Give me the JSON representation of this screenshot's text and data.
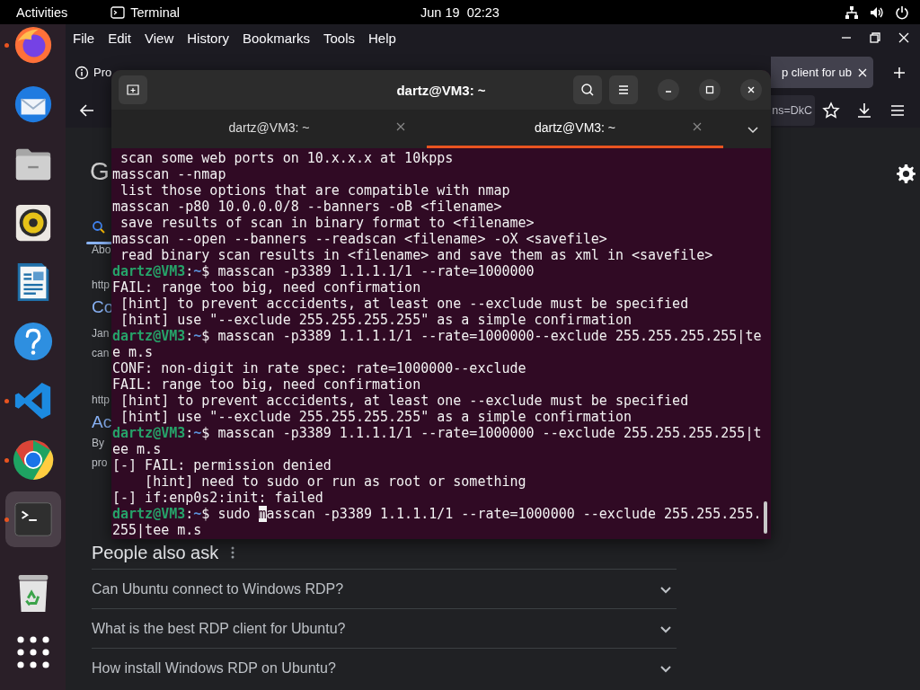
{
  "top_bar": {
    "activities": "Activities",
    "app": "Terminal",
    "clock": "Jun 19  02:23"
  },
  "dock": {
    "items": [
      {
        "kind": "firefox",
        "running": true,
        "selected": false
      },
      {
        "kind": "thunderbird",
        "running": false,
        "selected": false
      },
      {
        "kind": "files",
        "running": false,
        "selected": false
      },
      {
        "kind": "rhythmbox",
        "running": false,
        "selected": false
      },
      {
        "kind": "writer",
        "running": false,
        "selected": false
      },
      {
        "kind": "help",
        "running": false,
        "selected": false
      },
      {
        "kind": "vscode",
        "running": true,
        "selected": false
      },
      {
        "kind": "chrome",
        "running": true,
        "selected": false
      },
      {
        "kind": "terminal",
        "running": true,
        "selected": true
      },
      {
        "kind": "trash",
        "running": false,
        "selected": false
      }
    ]
  },
  "browser": {
    "menu": [
      "File",
      "Edit",
      "View",
      "History",
      "Bookmarks",
      "Tools",
      "Help"
    ],
    "tabs": [
      {
        "label": "Pro",
        "selected": false
      },
      {
        "label": "p client for ub",
        "selected": true
      }
    ],
    "url_fragment": "ns=DkC",
    "page_fragments": [
      {
        "kind": "logo",
        "text": "G"
      },
      {
        "kind": "snippet",
        "text": "Abo"
      },
      {
        "kind": "link",
        "text": "http"
      },
      {
        "kind": "title",
        "text": "Co"
      },
      {
        "kind": "snippet",
        "text": "Jan"
      },
      {
        "kind": "snippet",
        "text": "can"
      },
      {
        "kind": "link",
        "text": "http"
      },
      {
        "kind": "title",
        "text": "Ac"
      },
      {
        "kind": "snippet",
        "text": "By"
      },
      {
        "kind": "snippet",
        "text": "pro"
      }
    ],
    "people_also_ask": {
      "heading": "People also ask",
      "questions": [
        "Can Ubuntu connect to Windows RDP?",
        "What is the best RDP client for Ubuntu?",
        "How install Windows RDP on Ubuntu?"
      ]
    }
  },
  "terminal": {
    "title": "dartz@VM3: ~",
    "tabs": [
      {
        "label": "dartz@VM3: ~",
        "selected": false
      },
      {
        "label": "dartz@VM3: ~",
        "selected": true
      }
    ],
    "lines": [
      {
        "kind": "output",
        "text": " scan some web ports on 10.x.x.x at 10kpps"
      },
      {
        "kind": "output",
        "text": "masscan --nmap"
      },
      {
        "kind": "output",
        "text": " list those options that are compatible with nmap"
      },
      {
        "kind": "output",
        "text": "masscan -p80 10.0.0.0/8 --banners -oB <filename>"
      },
      {
        "kind": "output",
        "text": " save results of scan in binary format to <filename>"
      },
      {
        "kind": "output",
        "text": "masscan --open --banners --readscan <filename> -oX <savefile>"
      },
      {
        "kind": "output",
        "text": " read binary scan results in <filename> and save them as xml in <savefile>"
      },
      {
        "kind": "prompt",
        "user": "dartz@VM3",
        "colon": ":",
        "path": "~",
        "sign": "$",
        "command": "masscan -p3389 1.1.1.1/1 --rate=1000000"
      },
      {
        "kind": "output",
        "text": "FAIL: range too big, need confirmation"
      },
      {
        "kind": "output",
        "text": " [hint] to prevent acccidents, at least one --exclude must be specified"
      },
      {
        "kind": "output",
        "text": " [hint] use \"--exclude 255.255.255.255\" as a simple confirmation"
      },
      {
        "kind": "prompt",
        "user": "dartz@VM3",
        "colon": ":",
        "path": "~",
        "sign": "$",
        "command": "masscan -p3389 1.1.1.1/1 --rate=1000000--exclude 255.255.255.255|te"
      },
      {
        "kind": "output",
        "text": "e m.s"
      },
      {
        "kind": "output",
        "text": "CONF: non-digit in rate spec: rate=1000000--exclude"
      },
      {
        "kind": "output",
        "text": "FAIL: range too big, need confirmation"
      },
      {
        "kind": "output",
        "text": " [hint] to prevent acccidents, at least one --exclude must be specified"
      },
      {
        "kind": "output",
        "text": " [hint] use \"--exclude 255.255.255.255\" as a simple confirmation"
      },
      {
        "kind": "prompt",
        "user": "dartz@VM3",
        "colon": ":",
        "path": "~",
        "sign": "$",
        "command": "masscan -p3389 1.1.1.1/1 --rate=1000000 --exclude 255.255.255.255|t"
      },
      {
        "kind": "output",
        "text": "ee m.s"
      },
      {
        "kind": "output",
        "text": "[-] FAIL: permission denied"
      },
      {
        "kind": "output",
        "text": "    [hint] need to sudo or run as root or something"
      },
      {
        "kind": "output",
        "text": "[-] if:enp0s2:init: failed"
      },
      {
        "kind": "prompt",
        "user": "dartz@VM3",
        "colon": ":",
        "path": "~",
        "sign": "$",
        "command": "sudo ",
        "cursor": "m",
        "command_rest": "asscan -p3389 1.1.1.1/1 --rate=1000000 --exclude 255.255.255."
      },
      {
        "kind": "output",
        "text": "255|tee m.s"
      }
    ]
  }
}
